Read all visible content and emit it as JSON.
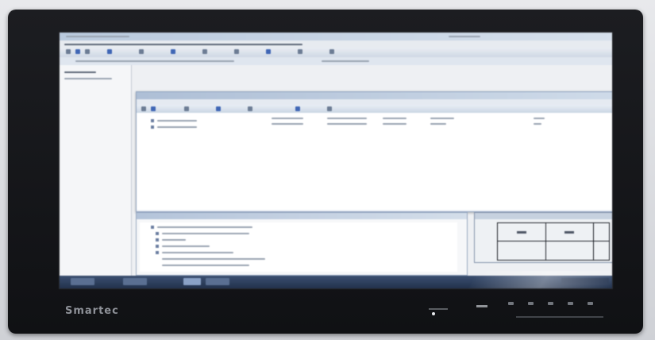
{
  "scene": {
    "device": "monitor",
    "brand_logo_text": "Smartec",
    "colors": {
      "bezel": "#141518",
      "screen_bg": "#eef0f3",
      "titlebar": "#b9c9dd",
      "taskbar": "#2e4263"
    }
  },
  "screen": {
    "windows": [
      {
        "name": "main-application-window"
      },
      {
        "name": "device-list-window"
      },
      {
        "name": "event-log-window"
      },
      {
        "name": "layout-grid-window"
      }
    ],
    "layout_grid": {
      "rows": 2,
      "cols": 3
    }
  }
}
